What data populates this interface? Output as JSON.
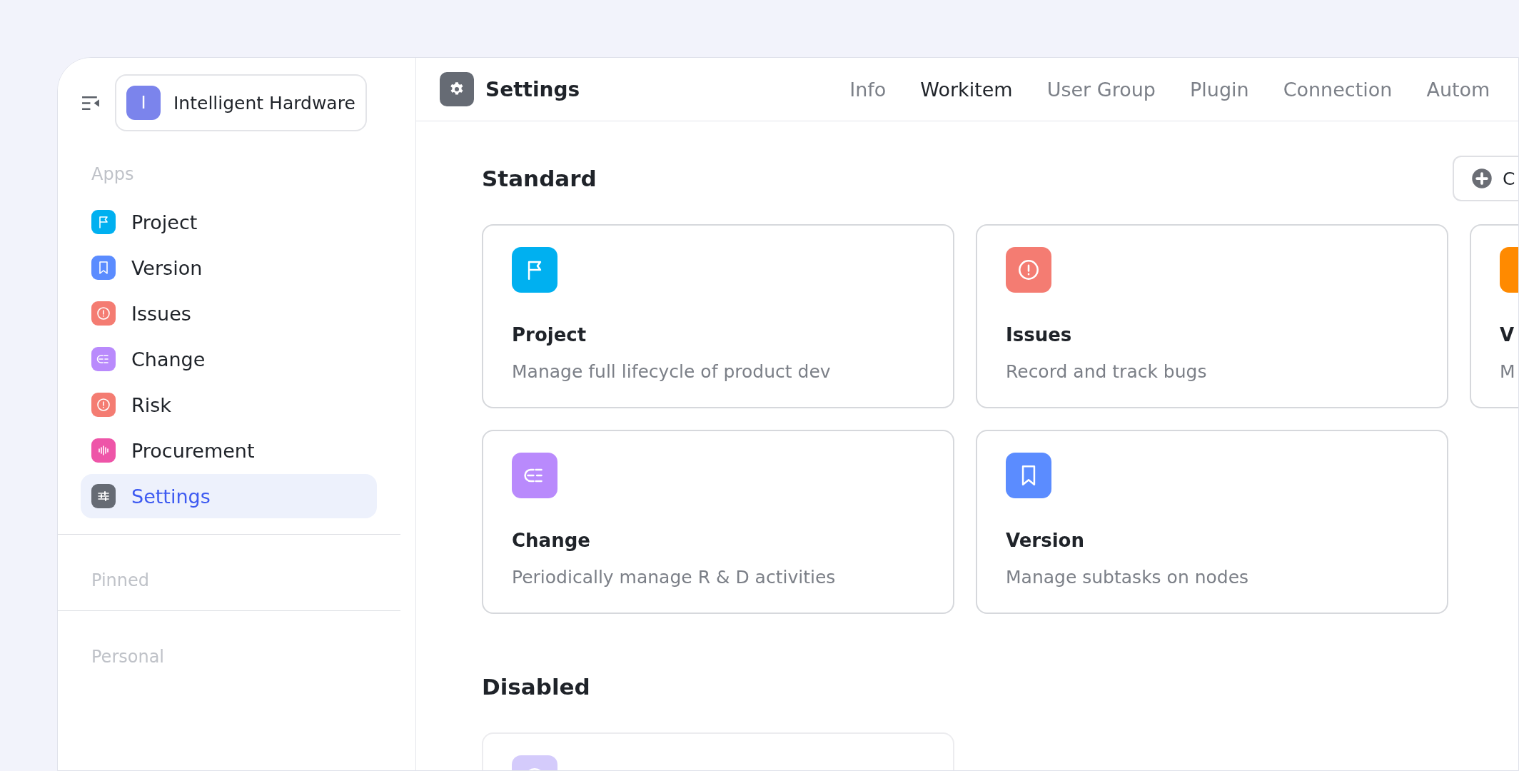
{
  "workspace": {
    "initial": "I",
    "name": "Intelligent Hardware",
    "color": "#7b84ec"
  },
  "sidebar": {
    "sections": [
      {
        "title": "Apps",
        "items": [
          {
            "label": "Project",
            "kind": "flag",
            "color": "#00b0f0",
            "selected": false
          },
          {
            "label": "Version",
            "kind": "bookmark",
            "color": "#5b8cff",
            "selected": false
          },
          {
            "label": "Issues",
            "kind": "alert",
            "color": "#f47c72",
            "selected": false
          },
          {
            "label": "Change",
            "kind": "change",
            "color": "#b98afc",
            "selected": false
          },
          {
            "label": "Risk",
            "kind": "alert",
            "color": "#f47c72",
            "selected": false
          },
          {
            "label": "Procurement",
            "kind": "wave",
            "color": "#ee55a8",
            "selected": false
          },
          {
            "label": "Settings",
            "kind": "sliders",
            "color": "#666b74",
            "selected": true
          }
        ]
      },
      {
        "title": "Pinned"
      },
      {
        "title": "Personal"
      }
    ]
  },
  "header": {
    "title": "Settings",
    "tabs": [
      {
        "label": "Info",
        "selected": false
      },
      {
        "label": "Workitem",
        "selected": true
      },
      {
        "label": "User Group",
        "selected": false
      },
      {
        "label": "Plugin",
        "selected": false
      },
      {
        "label": "Connection",
        "selected": false
      },
      {
        "label": "Autom",
        "selected": false
      }
    ]
  },
  "sections": [
    {
      "title": "Standard",
      "action": {
        "label": "C"
      },
      "cards": [
        {
          "kind": "flag",
          "color": "#00b0f0",
          "title": "Project",
          "description": "Manage full lifecycle of product dev",
          "disabled": false
        },
        {
          "kind": "alert",
          "color": "#f47c72",
          "title": "Issues",
          "description": "Record and track bugs",
          "disabled": false
        },
        {
          "kind": "blank",
          "color": "#ff8a00",
          "title": "V",
          "description": "M",
          "disabled": false
        },
        {
          "kind": "change",
          "color": "#b98afc",
          "title": "Change",
          "description": "Periodically manage R & D activities",
          "disabled": false
        },
        {
          "kind": "bookmark",
          "color": "#5b8cff",
          "title": "Version",
          "description": "Manage subtasks on nodes",
          "disabled": false
        }
      ]
    },
    {
      "title": "Disabled",
      "cards": [
        {
          "kind": "alert",
          "color": "#d4cbfb",
          "disabled": true
        }
      ]
    }
  ]
}
